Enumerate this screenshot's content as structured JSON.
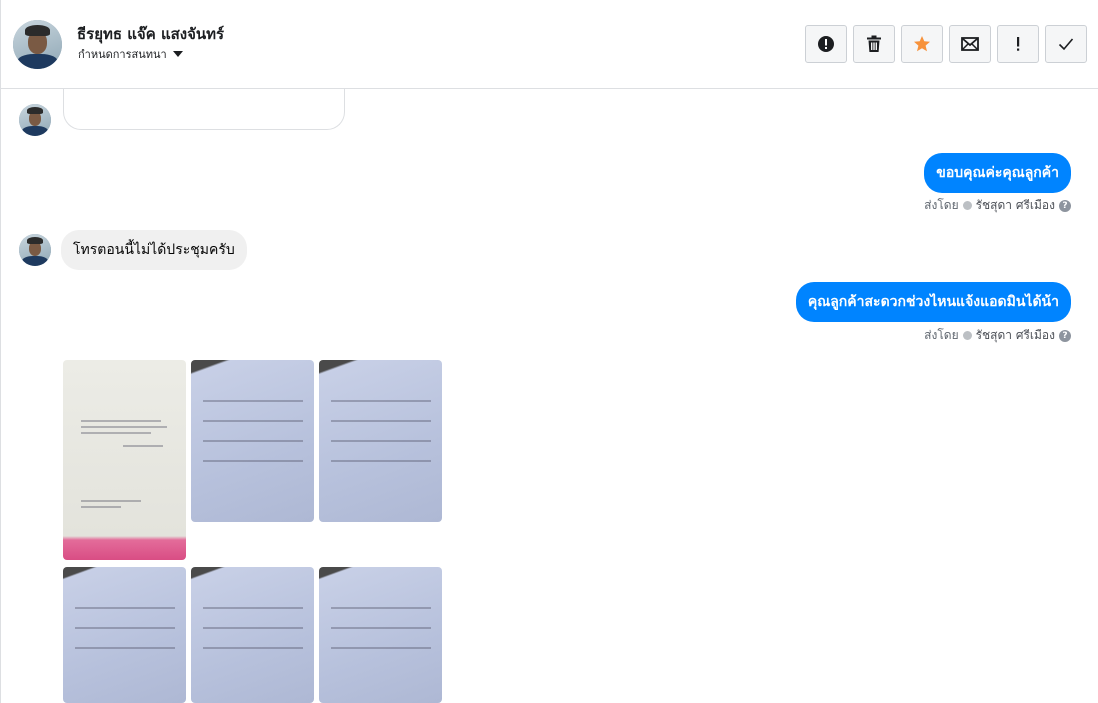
{
  "header": {
    "contact_name": "ธีรยุทธ แจ๊ค แสงจันทร์",
    "assign_label": "กำหนดการสนทนา",
    "toolbar": [
      {
        "name": "spam-button",
        "icon": "alert-circle-icon"
      },
      {
        "name": "delete-button",
        "icon": "trash-icon"
      },
      {
        "name": "star-button",
        "icon": "star-icon",
        "color": "#f7923b"
      },
      {
        "name": "mark-unread-button",
        "icon": "envelope-icon"
      },
      {
        "name": "follow-up-button",
        "icon": "exclamation-icon"
      },
      {
        "name": "mark-done-button",
        "icon": "checkmark-icon"
      }
    ]
  },
  "messages": [
    {
      "type": "image-partial",
      "direction": "incoming"
    },
    {
      "type": "text",
      "direction": "outgoing",
      "text": "ขอบคุณค่ะคุณลูกค้า",
      "sent_by_label": "ส่งโดย",
      "agent": "รัชสุดา ศรีเมือง"
    },
    {
      "type": "text",
      "direction": "incoming",
      "text": "โทรตอนนี้ไม่ได้ประชุมครับ"
    },
    {
      "type": "text",
      "direction": "outgoing",
      "text": "คุณลูกค้าสะดวกช่วงไหนแจ้งแอดมินได้น้า",
      "sent_by_label": "ส่งโดย",
      "agent": "รัชสุดา ศรีเมือง"
    },
    {
      "type": "photo-grid",
      "direction": "incoming",
      "count": 6
    }
  ],
  "colors": {
    "outgoing_bubble": "#0084ff",
    "incoming_bubble": "#f0f0f0",
    "star": "#f7923b"
  }
}
